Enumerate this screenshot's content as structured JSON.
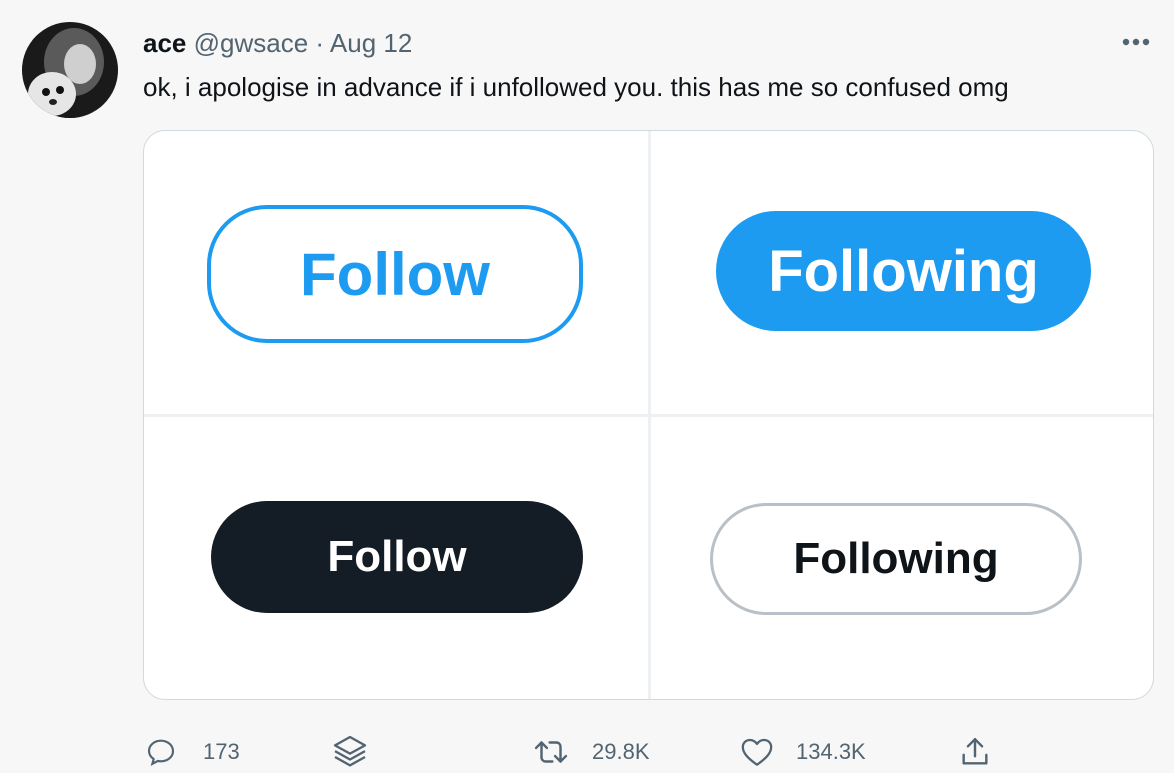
{
  "tweet": {
    "author_name": "ace",
    "handle": "@gwsace",
    "separator": "·",
    "date": "Aug 12",
    "text": "ok, i apologise in advance if i unfollowed you. this has me so confused omg"
  },
  "media": {
    "buttons": [
      {
        "label": "Follow",
        "style": "outline-blue"
      },
      {
        "label": "Following",
        "style": "filled-blue"
      },
      {
        "label": "Follow",
        "style": "filled-dark"
      },
      {
        "label": "Following",
        "style": "outline-gray"
      }
    ]
  },
  "actions": {
    "replies": "173",
    "retweets": "29.8K",
    "likes": "134.3K"
  },
  "colors": {
    "accent": "#1d9bf0",
    "dark": "#141c25",
    "muted": "#536471"
  },
  "icons": [
    "more-icon",
    "reply-icon",
    "stack-icon",
    "retweet-icon",
    "like-icon",
    "share-icon"
  ]
}
